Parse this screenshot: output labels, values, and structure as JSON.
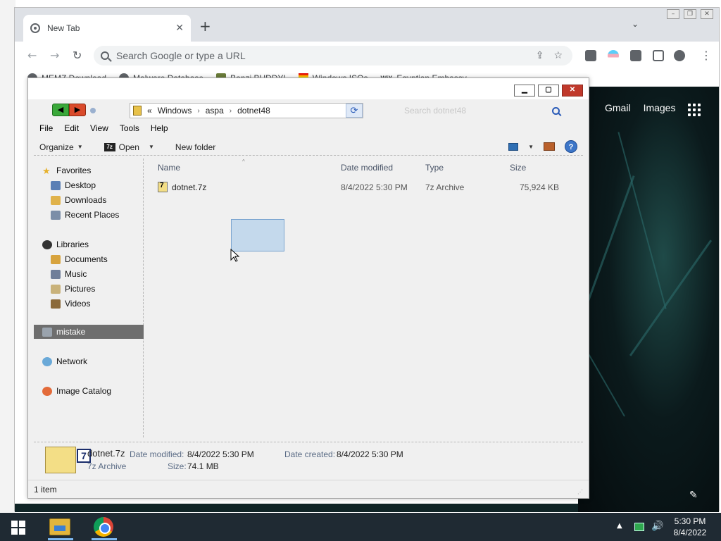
{
  "browser": {
    "tab_title": "New Tab",
    "omnibox_placeholder": "Search Google or type a URL",
    "bookmarks": [
      {
        "label": "MEMZ Download"
      },
      {
        "label": "Malware Database"
      },
      {
        "label": "Bonzi BUDDY!"
      },
      {
        "label": "Windows ISOs"
      },
      {
        "label": "Egyptian Embassy"
      }
    ],
    "ntp_links": {
      "gmail": "Gmail",
      "images": "Images"
    }
  },
  "explorer": {
    "address": {
      "prefix": "«",
      "segments": [
        "Windows",
        "aspa",
        "dotnet48"
      ]
    },
    "search_placeholder": "Search dotnet48",
    "menu": [
      "File",
      "Edit",
      "View",
      "Tools",
      "Help"
    ],
    "commands": {
      "organize": "Organize",
      "open": "Open",
      "new_folder": "New folder"
    },
    "nav": {
      "favorites": "Favorites",
      "desktop": "Desktop",
      "downloads": "Downloads",
      "recent": "Recent Places",
      "libraries": "Libraries",
      "documents": "Documents",
      "music": "Music",
      "pictures": "Pictures",
      "videos": "Videos",
      "mistake": "mistake",
      "network": "Network",
      "image_catalog": "Image Catalog"
    },
    "columns": {
      "name": "Name",
      "date": "Date modified",
      "type": "Type",
      "size": "Size"
    },
    "files": [
      {
        "name": "dotnet.7z",
        "date": "8/4/2022 5:30 PM",
        "type": "7z Archive",
        "size": "75,924 KB"
      }
    ],
    "details": {
      "name": "dotnet.7z",
      "type": "7z Archive",
      "date_modified_label": "Date modified:",
      "date_modified": "8/4/2022 5:30 PM",
      "size_label": "Size:",
      "size": "74.1 MB",
      "date_created_label": "Date created:",
      "date_created": "8/4/2022 5:30 PM"
    },
    "status": "1 item"
  },
  "taskbar": {
    "time": "5:30 PM",
    "date": "8/4/2022"
  }
}
